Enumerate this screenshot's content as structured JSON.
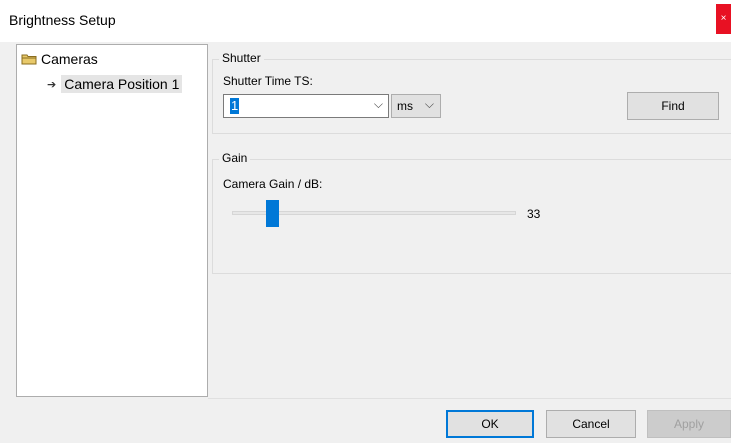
{
  "window": {
    "title": "Brightness Setup",
    "close_glyph": "×",
    "close_color": "#e81123"
  },
  "tree": {
    "root": {
      "label": "Cameras",
      "icon": "folder-icon"
    },
    "children": [
      {
        "label": "Camera Position 1",
        "icon": "arrow-icon",
        "selected": true
      }
    ]
  },
  "shutter": {
    "group_label": "Shutter",
    "field_label": "Shutter Time TS:",
    "value": "1",
    "unit": "ms",
    "find_label": "Find"
  },
  "gain": {
    "group_label": "Gain",
    "field_label": "Camera Gain / dB:",
    "value": "33",
    "slider_fraction": 0.14
  },
  "buttons": {
    "ok": "OK",
    "cancel": "Cancel",
    "apply": "Apply"
  },
  "colors": {
    "accent": "#0078d7",
    "window_bg": "#f0f0f0"
  }
}
